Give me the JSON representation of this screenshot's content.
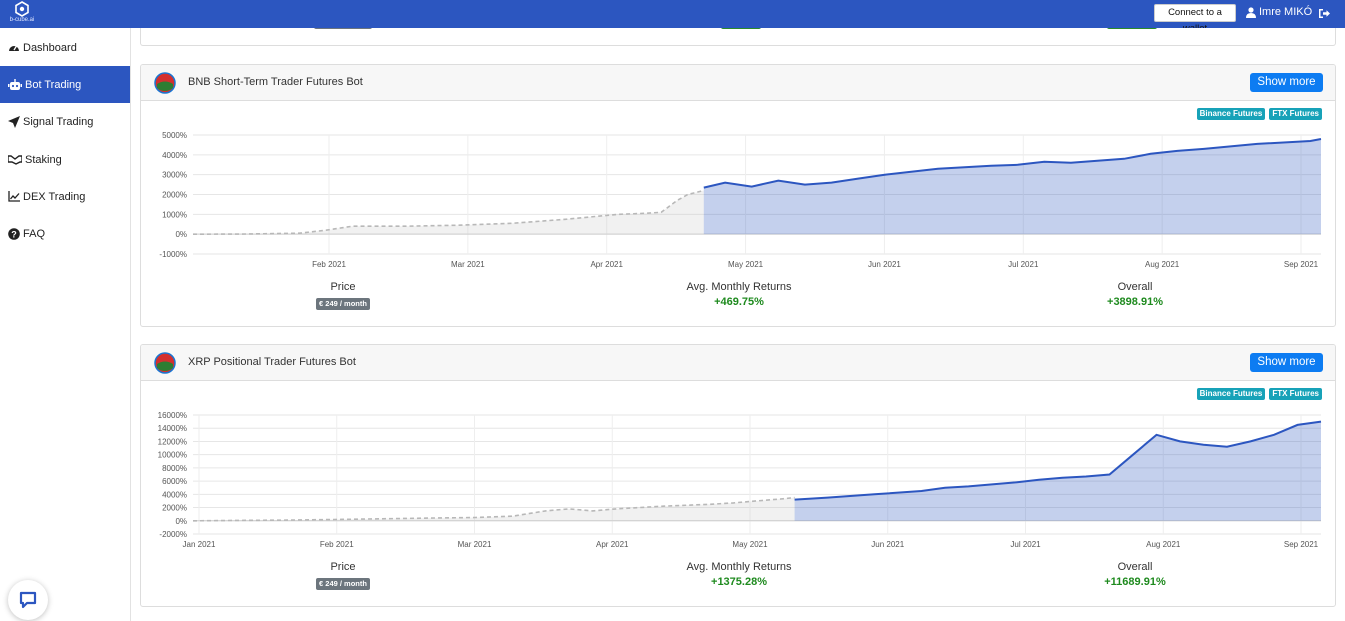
{
  "brand": {
    "logo_text": "b-cube.ai",
    "color": "#2c56c0"
  },
  "topbar": {
    "connect_label": "Connect to a wallet",
    "user_name": "Imre MIKÓ"
  },
  "sidebar": {
    "items": [
      {
        "label": "Dashboard",
        "icon": "tachometer-icon"
      },
      {
        "label": "Bot Trading",
        "icon": "robot-icon",
        "active": true
      },
      {
        "label": "Signal Trading",
        "icon": "paper-plane-icon"
      },
      {
        "label": "Staking",
        "icon": "handshake-icon"
      },
      {
        "label": "DEX Trading",
        "icon": "line-chart-icon"
      },
      {
        "label": "FAQ",
        "icon": "question-circle-icon"
      }
    ]
  },
  "bots": [
    {
      "title": "BNB Short-Term Trader Futures Bot",
      "show_more": "Show more",
      "tags": [
        "Binance Futures",
        "FTX Futures"
      ],
      "price_label": "Price",
      "price": "€ 249 / month",
      "returns_label": "Avg. Monthly Returns",
      "returns": "+469.75%",
      "overall_label": "Overall",
      "overall": "+3898.91%",
      "chart_data": {
        "type": "area",
        "y_ticks": [
          "5000%",
          "4000%",
          "3000%",
          "2000%",
          "1000%",
          "0%",
          "-1000%"
        ],
        "ylim": [
          -1000,
          5000
        ],
        "x_ticks": [
          "Feb 2021",
          "Mar 2021",
          "Apr 2021",
          "May 2021",
          "Jun 2021",
          "Jul 2021",
          "Aug 2021",
          "Sep 2021"
        ],
        "grid": true,
        "series": [
          {
            "style": "dashed-gray",
            "x": [
              0,
              10,
              20,
              25,
              30,
              35,
              40,
              50,
              60,
              70,
              80,
              85,
              88,
              91,
              93,
              96
            ],
            "y": [
              0,
              10,
              50,
              200,
              400,
              400,
              400,
              450,
              550,
              750,
              1000,
              1050,
              1100,
              1700,
              2000,
              2200
            ]
          },
          {
            "style": "solid-blue",
            "x": [
              96,
              100,
              105,
              110,
              115,
              120,
              125,
              130,
              140,
              150,
              155,
              160,
              165,
              170,
              175,
              180,
              185,
              190,
              200,
              210,
              212
            ],
            "y": [
              2350,
              2600,
              2400,
              2700,
              2500,
              2600,
              2800,
              3000,
              3300,
              3450,
              3500,
              3650,
              3600,
              3700,
              3800,
              4050,
              4200,
              4300,
              4550,
              4700,
              4800
            ]
          }
        ]
      }
    },
    {
      "title": "XRP Positional Trader Futures Bot",
      "show_more": "Show more",
      "tags": [
        "Binance Futures",
        "FTX Futures"
      ],
      "price_label": "Price",
      "price": "€ 249 / month",
      "returns_label": "Avg. Monthly Returns",
      "returns": "+1375.28%",
      "overall_label": "Overall",
      "overall": "+11689.91%",
      "chart_data": {
        "type": "area",
        "y_ticks": [
          "16000%",
          "14000%",
          "12000%",
          "10000%",
          "8000%",
          "6000%",
          "4000%",
          "2000%",
          "0%",
          "-2000%"
        ],
        "ylim": [
          -2000,
          16000
        ],
        "x_ticks": [
          "Jan 2021",
          "Feb 2021",
          "Mar 2021",
          "Apr 2021",
          "May 2021",
          "Jun 2021",
          "Jul 2021",
          "Aug 2021",
          "Sep 2021"
        ],
        "grid": true,
        "series": [
          {
            "style": "dashed-gray",
            "x": [
              0,
              10,
              20,
              30,
              40,
              50,
              60,
              68,
              75,
              80,
              85,
              90,
              100,
              110,
              115,
              120,
              125,
              128
            ],
            "y": [
              0,
              50,
              100,
              200,
              300,
              400,
              500,
              700,
              1500,
              1800,
              1500,
              1800,
              2200,
              2500,
              2700,
              3000,
              3300,
              3500
            ]
          },
          {
            "style": "solid-blue",
            "x": [
              128,
              135,
              145,
              155,
              160,
              165,
              170,
              175,
              180,
              185,
              190,
              195,
              200,
              205,
              210,
              215,
              220,
              225,
              230,
              235,
              240
            ],
            "y": [
              3200,
              3500,
              4000,
              4500,
              5000,
              5200,
              5500,
              5800,
              6200,
              6500,
              6700,
              7000,
              10000,
              13000,
              12000,
              11500,
              11200,
              12000,
              13000,
              14500,
              15000
            ]
          }
        ]
      }
    }
  ]
}
